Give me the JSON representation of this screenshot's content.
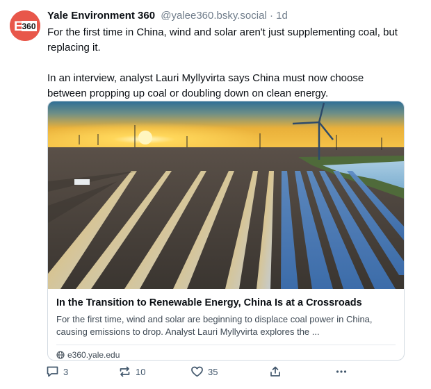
{
  "post": {
    "author": {
      "display_name": "Yale Environment 360",
      "handle": "@yalee360.bsky.social",
      "avatar_text": "E360",
      "avatar_color": "#e8574a"
    },
    "separator": "·",
    "time": "1d",
    "text": [
      "For the first time in China, wind and solar aren't just supplementing coal, but replacing it.",
      "In an interview, analyst Lauri Myllyvirta says China must now choose between propping up coal or doubling down on clean energy."
    ],
    "card": {
      "title": "In the Transition to Renewable Energy, China Is at a Crossroads",
      "description": "For the first time, wind and solar are beginning to displace coal power in China, causing emissions to drop. Analyst Lauri Myllyvirta explores the ...",
      "domain": "e360.yale.edu"
    },
    "actions": {
      "replies": "3",
      "reposts": "10",
      "likes": "35",
      "share_icon": "share-icon",
      "more_icon": "more-icon"
    },
    "colors": {
      "text": "#0b0f14",
      "muted": "#6f7c8a",
      "action": "#42576c",
      "border": "#d4dbe2"
    }
  }
}
